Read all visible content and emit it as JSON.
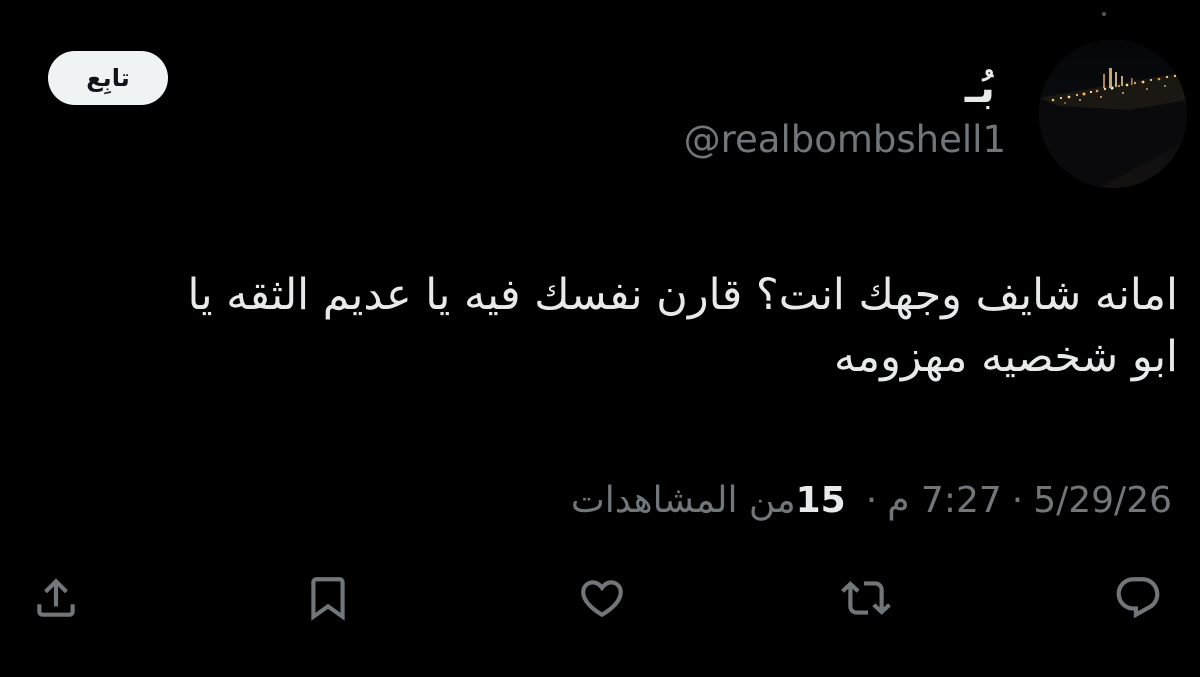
{
  "author": {
    "display_name": "بُـ",
    "handle": "@realbombshell1"
  },
  "follow_button": {
    "label": "تابِع"
  },
  "tweet": {
    "lines": [
      "امانه شايف وجهك انت؟ قارن نفسك فيه يا عديم الثقه يا",
      "ابو شخصيه مهزومه"
    ]
  },
  "meta": {
    "date": "5/29/26",
    "time": "7:27 م",
    "views_count": "15",
    "views_label": "من المشاهدات",
    "separator": "·"
  },
  "actions": {
    "icons": [
      "reply-icon",
      "retweet-icon",
      "like-icon",
      "bookmark-icon",
      "share-icon"
    ]
  },
  "colors": {
    "background": "#000000",
    "text": "#e7e9ea",
    "secondary": "#71767b",
    "follow_bg": "#eff3f4"
  }
}
